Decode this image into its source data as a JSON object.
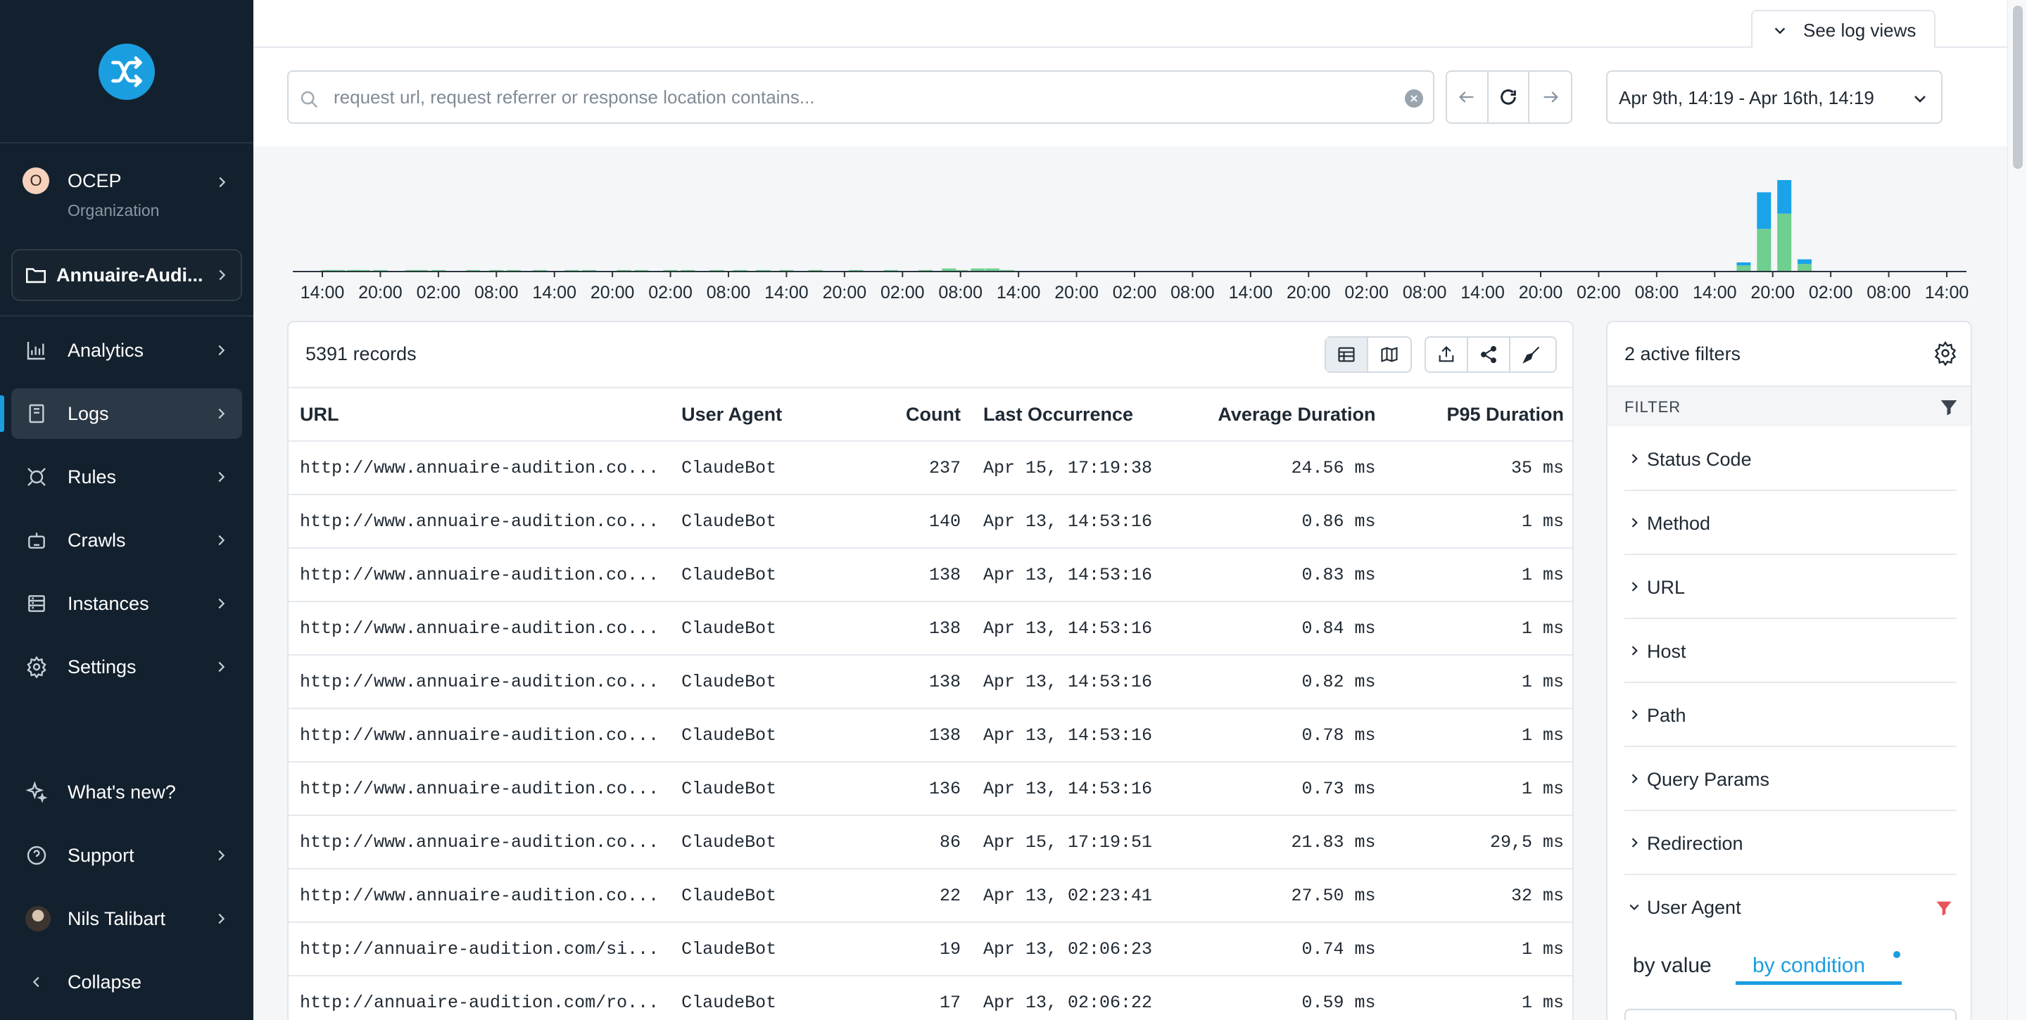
{
  "sidebar": {
    "org": {
      "initial": "O",
      "name": "OCEP",
      "subtitle": "Organization"
    },
    "project": {
      "name": "Annuaire-Audi..."
    },
    "nav": [
      {
        "label": "Analytics",
        "icon": "bar-chart-icon"
      },
      {
        "label": "Logs",
        "icon": "document-icon",
        "active": true
      },
      {
        "label": "Rules",
        "icon": "rules-icon"
      },
      {
        "label": "Crawls",
        "icon": "robot-icon"
      },
      {
        "label": "Instances",
        "icon": "server-icon"
      },
      {
        "label": "Settings",
        "icon": "gear-icon"
      }
    ],
    "bottom": {
      "whats_new": "What's new?",
      "support": "Support",
      "user": "Nils Talibart",
      "collapse": "Collapse"
    }
  },
  "header": {
    "see_log_views": "See log views",
    "search_placeholder": "request url, request referrer or response location contains...",
    "search_value": "",
    "date_range": "Apr 9th, 14:19 - Apr 16th, 14:19"
  },
  "histogram": {
    "type": "bar",
    "tick_labels": [
      "14:00",
      "20:00",
      "02:00",
      "08:00",
      "14:00",
      "20:00",
      "02:00",
      "08:00",
      "14:00",
      "20:00",
      "02:00",
      "08:00",
      "14:00",
      "20:00",
      "02:00",
      "08:00",
      "14:00",
      "20:00",
      "02:00",
      "08:00",
      "14:00",
      "20:00",
      "02:00",
      "08:00",
      "14:00",
      "20:00",
      "02:00",
      "08:00",
      "14:00"
    ],
    "series": [
      {
        "color": "#6fcf8e",
        "values": [
          0,
          0,
          0,
          0,
          0,
          0,
          0,
          0,
          0,
          0,
          0,
          0,
          0,
          0,
          0,
          0,
          0,
          0,
          0,
          0,
          0,
          0,
          0,
          0,
          0,
          0,
          0,
          0,
          0,
          0,
          0,
          0,
          0,
          0,
          0,
          0,
          0,
          0,
          0,
          0,
          0,
          0,
          0,
          0,
          0,
          0,
          0,
          0,
          0,
          0,
          0,
          0,
          0,
          0,
          0,
          0,
          0,
          0,
          0,
          0,
          0,
          0,
          0,
          0,
          0,
          0,
          0,
          0,
          0,
          0,
          0,
          0,
          0,
          0,
          0,
          0,
          0,
          0,
          0,
          0,
          0,
          0,
          0,
          0,
          0,
          0,
          0,
          0,
          0,
          0,
          0,
          0,
          0,
          0,
          0,
          0,
          0,
          0,
          0,
          0,
          0,
          0,
          0,
          0,
          0,
          0,
          0,
          0,
          0,
          0,
          0,
          0,
          0,
          0,
          0,
          0,
          0,
          0,
          0,
          0,
          0,
          0,
          0,
          0,
          0,
          0,
          0,
          0,
          0,
          0,
          0,
          0,
          0,
          0,
          0,
          0,
          0,
          0,
          0,
          0,
          0,
          0,
          0,
          0,
          0,
          0,
          0,
          0,
          0,
          0,
          0,
          0,
          0,
          0,
          0,
          0,
          0,
          0,
          0,
          0,
          0,
          0,
          0,
          0,
          0,
          0,
          0,
          0
        ]
      },
      {
        "color": "#1aa3e8",
        "values": []
      }
    ],
    "bars": [
      {
        "pos": 0.1,
        "green": 1
      },
      {
        "pos": 0.18,
        "green": 1
      },
      {
        "pos": 0.27,
        "green": 1
      },
      {
        "pos": 0.55,
        "green": 1
      },
      {
        "pos": 0.7,
        "green": 1
      },
      {
        "pos": 1.0,
        "green": 1
      },
      {
        "pos": 1.55,
        "green": 1
      },
      {
        "pos": 1.7,
        "green": 1
      },
      {
        "pos": 2.0,
        "green": 1
      },
      {
        "pos": 2.6,
        "green": 1
      },
      {
        "pos": 3.0,
        "green": 1
      },
      {
        "pos": 3.3,
        "green": 1
      },
      {
        "pos": 3.75,
        "green": 1
      },
      {
        "pos": 4.3,
        "green": 1
      },
      {
        "pos": 4.6,
        "green": 1
      },
      {
        "pos": 5.2,
        "green": 1
      },
      {
        "pos": 5.5,
        "green": 1
      },
      {
        "pos": 6.0,
        "green": 1
      },
      {
        "pos": 6.3,
        "green": 1
      },
      {
        "pos": 6.8,
        "green": 1
      },
      {
        "pos": 7.2,
        "green": 1
      },
      {
        "pos": 7.6,
        "green": 1
      },
      {
        "pos": 8.0,
        "green": 1
      },
      {
        "pos": 8.5,
        "green": 1
      },
      {
        "pos": 9.2,
        "green": 1
      },
      {
        "pos": 9.8,
        "green": 1
      },
      {
        "pos": 10.4,
        "green": 1
      },
      {
        "pos": 10.8,
        "green": 2
      },
      {
        "pos": 11.0,
        "green": 1
      },
      {
        "pos": 11.3,
        "green": 2
      },
      {
        "pos": 11.55,
        "green": 2
      },
      {
        "pos": 11.8,
        "green": 1
      },
      {
        "pos": 24.5,
        "green": 4,
        "blue": 2
      },
      {
        "pos": 24.85,
        "green": 28,
        "blue": 24
      },
      {
        "pos": 25.2,
        "green": 38,
        "blue": 22
      },
      {
        "pos": 25.55,
        "green": 5,
        "blue": 3
      }
    ],
    "ymax": 60
  },
  "table": {
    "records": "5391 records",
    "columns": [
      "URL",
      "User Agent",
      "Count",
      "Last Occurrence",
      "Average Duration",
      "P95 Duration"
    ],
    "rows": [
      [
        "http://www.annuaire-audition.co...",
        "ClaudeBot",
        "237",
        "Apr 15, 17:19:38",
        "24.56 ms",
        "35 ms"
      ],
      [
        "http://www.annuaire-audition.co...",
        "ClaudeBot",
        "140",
        "Apr 13, 14:53:16",
        "0.86 ms",
        "1 ms"
      ],
      [
        "http://www.annuaire-audition.co...",
        "ClaudeBot",
        "138",
        "Apr 13, 14:53:16",
        "0.83 ms",
        "1 ms"
      ],
      [
        "http://www.annuaire-audition.co...",
        "ClaudeBot",
        "138",
        "Apr 13, 14:53:16",
        "0.84 ms",
        "1 ms"
      ],
      [
        "http://www.annuaire-audition.co...",
        "ClaudeBot",
        "138",
        "Apr 13, 14:53:16",
        "0.82 ms",
        "1 ms"
      ],
      [
        "http://www.annuaire-audition.co...",
        "ClaudeBot",
        "138",
        "Apr 13, 14:53:16",
        "0.78 ms",
        "1 ms"
      ],
      [
        "http://www.annuaire-audition.co...",
        "ClaudeBot",
        "136",
        "Apr 13, 14:53:16",
        "0.73 ms",
        "1 ms"
      ],
      [
        "http://www.annuaire-audition.co...",
        "ClaudeBot",
        "86",
        "Apr 15, 17:19:51",
        "21.83 ms",
        "29,5 ms"
      ],
      [
        "http://www.annuaire-audition.co...",
        "ClaudeBot",
        "22",
        "Apr 13, 02:23:41",
        "27.50 ms",
        "32 ms"
      ],
      [
        "http://annuaire-audition.com/si...",
        "ClaudeBot",
        "19",
        "Apr 13, 02:06:23",
        "0.74 ms",
        "1 ms"
      ],
      [
        "http://annuaire-audition.com/ro...",
        "ClaudeBot",
        "17",
        "Apr 13, 02:06:22",
        "0.59 ms",
        "1 ms"
      ]
    ]
  },
  "filters": {
    "title": "2 active filters",
    "header": "FILTER",
    "items": [
      "Status Code",
      "Method",
      "URL",
      "Host",
      "Path",
      "Query Params",
      "Redirection",
      "User Agent"
    ],
    "user_agent_active": true,
    "tabs": {
      "by_value": "by value",
      "by_condition": "by condition"
    }
  },
  "colors": {
    "accent": "#1a9ee0",
    "sidebar_bg": "#13212e",
    "filter_active": "#e8545b"
  }
}
